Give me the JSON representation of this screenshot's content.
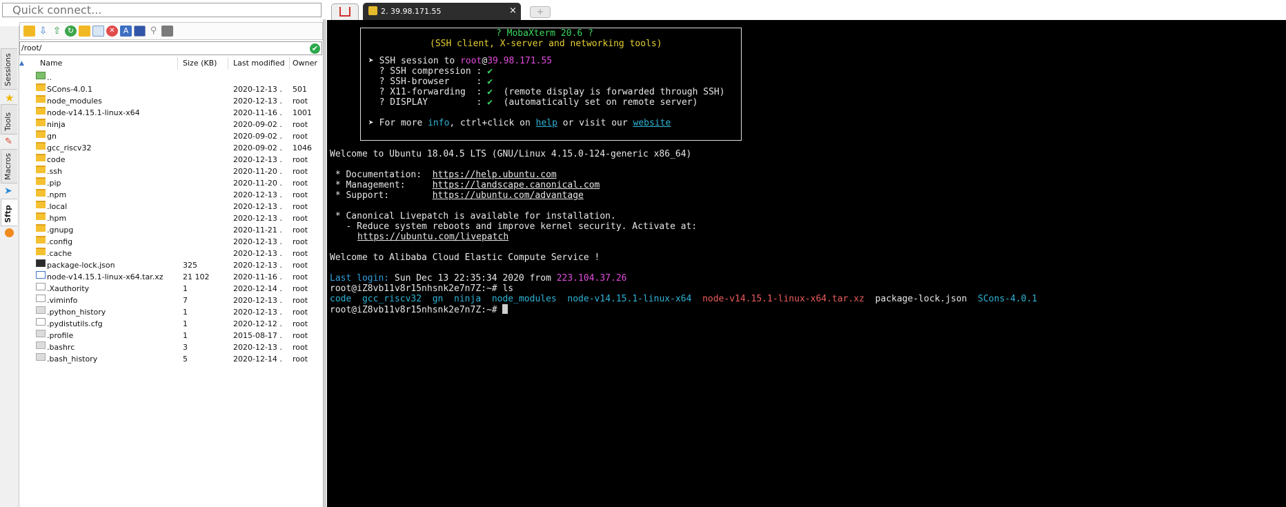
{
  "quick_connect": {
    "placeholder": "Quick connect..."
  },
  "side_tabs": [
    {
      "label": "Sessions"
    },
    {
      "label": "Tools"
    },
    {
      "label": "Macros"
    },
    {
      "label": "Sftp"
    }
  ],
  "sftp": {
    "path": "/root/",
    "columns": {
      "name": "Name",
      "size": "Size (KB)",
      "modified": "Last modified",
      "owner": "Owner"
    },
    "rows": [
      {
        "name": "..",
        "size": "",
        "modified": "",
        "owner": "",
        "icon": "up"
      },
      {
        "name": "SCons-4.0.1",
        "size": "",
        "modified": "2020-12-13 ...",
        "owner": "501",
        "icon": "folder"
      },
      {
        "name": "node_modules",
        "size": "",
        "modified": "2020-12-13 ...",
        "owner": "root",
        "icon": "folder"
      },
      {
        "name": "node-v14.15.1-linux-x64",
        "size": "",
        "modified": "2020-11-16 ...",
        "owner": "1001",
        "icon": "folder"
      },
      {
        "name": "ninja",
        "size": "",
        "modified": "2020-09-02 ...",
        "owner": "root",
        "icon": "folder"
      },
      {
        "name": "gn",
        "size": "",
        "modified": "2020-09-02 ...",
        "owner": "root",
        "icon": "folder"
      },
      {
        "name": "gcc_riscv32",
        "size": "",
        "modified": "2020-09-02 ...",
        "owner": "1046",
        "icon": "folder"
      },
      {
        "name": "code",
        "size": "",
        "modified": "2020-12-13 ...",
        "owner": "root",
        "icon": "folder"
      },
      {
        "name": ".ssh",
        "size": "",
        "modified": "2020-11-20 ...",
        "owner": "root",
        "icon": "folder"
      },
      {
        "name": ".pip",
        "size": "",
        "modified": "2020-11-20 ...",
        "owner": "root",
        "icon": "folder"
      },
      {
        "name": ".npm",
        "size": "",
        "modified": "2020-12-13 ...",
        "owner": "root",
        "icon": "folder"
      },
      {
        "name": ".local",
        "size": "",
        "modified": "2020-12-13 ...",
        "owner": "root",
        "icon": "folder"
      },
      {
        "name": ".hpm",
        "size": "",
        "modified": "2020-12-13 ...",
        "owner": "root",
        "icon": "folder"
      },
      {
        "name": ".gnupg",
        "size": "",
        "modified": "2020-11-21 ...",
        "owner": "root",
        "icon": "folder"
      },
      {
        "name": ".config",
        "size": "",
        "modified": "2020-12-13 ...",
        "owner": "root",
        "icon": "folder"
      },
      {
        "name": ".cache",
        "size": "",
        "modified": "2020-12-13 ...",
        "owner": "root",
        "icon": "folder"
      },
      {
        "name": "package-lock.json",
        "size": "325",
        "modified": "2020-12-13 ...",
        "owner": "root",
        "icon": "json"
      },
      {
        "name": "node-v14.15.1-linux-x64.tar.xz",
        "size": "21 102",
        "modified": "2020-11-16 ...",
        "owner": "root",
        "icon": "xz"
      },
      {
        "name": ".Xauthority",
        "size": "1",
        "modified": "2020-12-14 ...",
        "owner": "root",
        "icon": "txt"
      },
      {
        "name": ".viminfo",
        "size": "7",
        "modified": "2020-12-13 ...",
        "owner": "root",
        "icon": "txt"
      },
      {
        "name": ".python_history",
        "size": "1",
        "modified": "2020-12-13 ...",
        "owner": "root",
        "icon": "file"
      },
      {
        "name": ".pydistutils.cfg",
        "size": "1",
        "modified": "2020-12-12 ...",
        "owner": "root",
        "icon": "txt"
      },
      {
        "name": ".profile",
        "size": "1",
        "modified": "2015-08-17 ...",
        "owner": "root",
        "icon": "file"
      },
      {
        "name": ".bashrc",
        "size": "3",
        "modified": "2020-12-13 ...",
        "owner": "root",
        "icon": "file"
      },
      {
        "name": ".bash_history",
        "size": "5",
        "modified": "2020-12-14 ...",
        "owner": "root",
        "icon": "file"
      }
    ]
  },
  "tabs": {
    "ssh_tab_label": "2. 39.98.171.55",
    "close": "×",
    "new_tab": "+"
  },
  "terminal": {
    "banner_title": "? MobaXterm 20.6 ?",
    "banner_subtitle": "(SSH client, X-server and networking tools)",
    "session_prefix": "➤ SSH session to ",
    "session_user": "root",
    "session_at": "@",
    "session_host": "39.98.171.55",
    "features": [
      {
        "label": "  ? SSH compression : ",
        "status": "✔",
        "note": ""
      },
      {
        "label": "  ? SSH-browser     : ",
        "status": "✔",
        "note": ""
      },
      {
        "label": "  ? X11-forwarding  : ",
        "status": "✔",
        "note": "  (remote display is forwarded through SSH)"
      },
      {
        "label": "  ? DISPLAY         : ",
        "status": "✔",
        "note": "  (automatically set on remote server)"
      }
    ],
    "more_prefix": "➤ For more ",
    "more_info": "info",
    "more_mid": ", ctrl+click on ",
    "more_help": "help",
    "more_or": " or visit our ",
    "more_website": "website",
    "welcome": "Welcome to Ubuntu 18.04.5 LTS (GNU/Linux 4.15.0-124-generic x86_64)",
    "doc_label": " * Documentation:  ",
    "doc_url": "https://help.ubuntu.com",
    "mgmt_label": " * Management:     ",
    "mgmt_url": "https://landscape.canonical.com",
    "support_label": " * Support:        ",
    "support_url": "https://ubuntu.com/advantage",
    "livepatch1": " * Canonical Livepatch is available for installation.",
    "livepatch2": "   - Reduce system reboots and improve kernel security. Activate at:",
    "livepatch_url": "https://ubuntu.com/livepatch",
    "alibaba": "Welcome to Alibaba Cloud Elastic Compute Service !",
    "last_login_label": "Last login:",
    "last_login_date": " Sun Dec 13 22:35:34 2020 from ",
    "last_login_ip": "223.104.37.26",
    "prompt1": "root@iZ8vb11v8r15nhsnk2e7n7Z:~# ls",
    "ls": [
      {
        "text": "code",
        "color": "#2fb3d6"
      },
      {
        "text": "gcc_riscv32",
        "color": "#2fb3d6"
      },
      {
        "text": "gn",
        "color": "#2fb3d6"
      },
      {
        "text": "ninja",
        "color": "#2fb3d6"
      },
      {
        "text": "node_modules",
        "color": "#2fb3d6"
      },
      {
        "text": "node-v14.15.1-linux-x64",
        "color": "#2fb3d6"
      },
      {
        "text": "node-v14.15.1-linux-x64.tar.xz",
        "color": "#ec5c5c"
      },
      {
        "text": "package-lock.json",
        "color": "#e8e8e8"
      },
      {
        "text": "SCons-4.0.1",
        "color": "#2fb3d6"
      }
    ],
    "prompt2": "root@iZ8vb11v8r15nhsnk2e7n7Z:~# "
  },
  "colors": {
    "folder": "#f5c131",
    "terminal_bg": "#000000",
    "accent": "#1b73c9"
  }
}
